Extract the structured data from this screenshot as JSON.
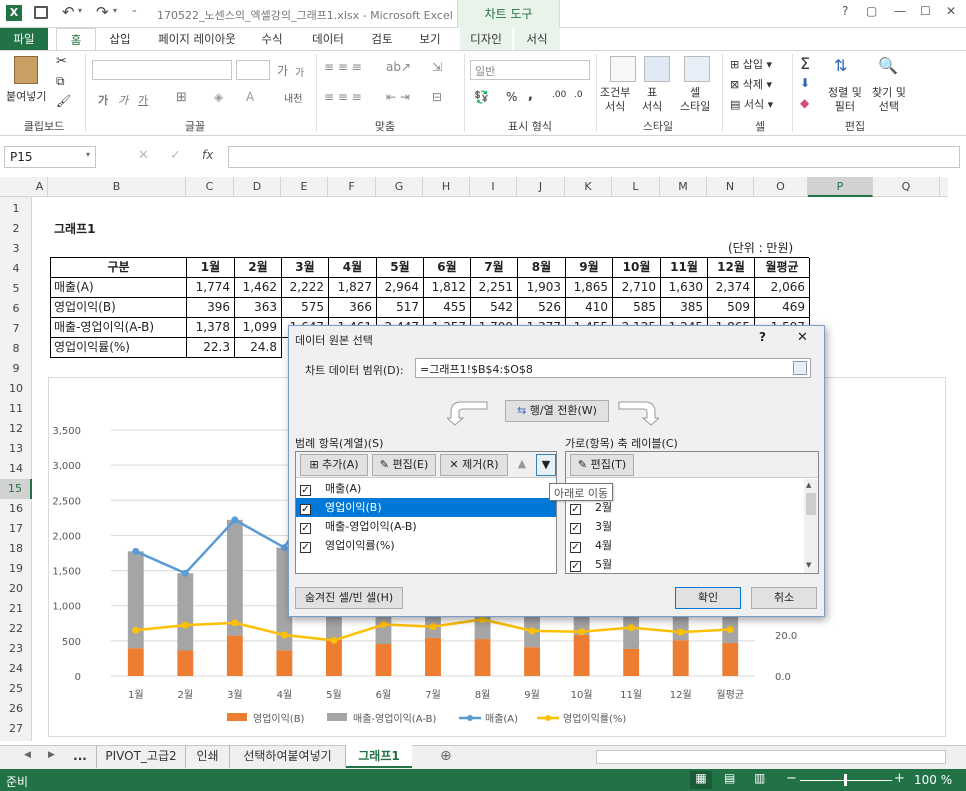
{
  "titlebar": {
    "title": "170522_노센스의_엑셀강의_그래프1.xlsx - Microsoft Excel",
    "chart_tools": "차트 도구",
    "help": "?",
    "restore": "▢",
    "minimize": "—",
    "maximize": "☐",
    "close": "✕"
  },
  "ribbon_tabs": [
    "파일",
    "홈",
    "삽입",
    "페이지 레이아웃",
    "수식",
    "데이터",
    "검토",
    "보기",
    "디자인",
    "서식"
  ],
  "ribbon": {
    "paste": "붙여넣기",
    "clipboard": "클립보드",
    "font": "글꼴",
    "alignment": "맞춤",
    "number_format_value": "일반",
    "number": "표시 형식",
    "cond_format": "조건부\n서식",
    "table_format": "표\n서식",
    "cell_style": "셀\n스타일",
    "styles": "스타일",
    "insert": "삽입",
    "delete": "삭제",
    "format": "서식",
    "cells": "셀",
    "sort_filter": "정렬 및\n필터",
    "find_select": "찾기 및\n선택",
    "editing": "편집",
    "font_size_a": "가",
    "font_size_b": "가",
    "bold": "가",
    "italic": "가",
    "underline": "가",
    "percent": "%",
    "comma": ",",
    "pct_char": "내천"
  },
  "formula_bar": {
    "name_box": "P15",
    "fx": "fx",
    "value": ""
  },
  "columns": [
    "A",
    "B",
    "C",
    "D",
    "E",
    "F",
    "G",
    "H",
    "I",
    "J",
    "K",
    "L",
    "M",
    "N",
    "O",
    "P",
    "Q"
  ],
  "rows": [
    "1",
    "2",
    "3",
    "4",
    "5",
    "6",
    "7",
    "8",
    "9",
    "10",
    "11",
    "12",
    "13",
    "14",
    "15",
    "16",
    "17",
    "18",
    "19",
    "20",
    "21",
    "22",
    "23",
    "24",
    "25",
    "26",
    "27"
  ],
  "sheet": {
    "title": "그래프1",
    "unit": "(단위 : 만원)",
    "header": [
      "구분",
      "1월",
      "2월",
      "3월",
      "4월",
      "5월",
      "6월",
      "7월",
      "8월",
      "9월",
      "10월",
      "11월",
      "12월",
      "월평균"
    ],
    "row_sales": [
      "매출(A)",
      "1,774",
      "1,462",
      "2,222",
      "1,827",
      "2,964",
      "1,812",
      "2,251",
      "1,903",
      "1,865",
      "2,710",
      "1,630",
      "2,374",
      "2,066"
    ],
    "row_profit": [
      "영업이익(B)",
      "396",
      "363",
      "575",
      "366",
      "517",
      "455",
      "542",
      "526",
      "410",
      "585",
      "385",
      "509",
      "469"
    ],
    "row_diff": [
      "매출-영업이익(A-B)",
      "1,378",
      "1,099",
      "1,647",
      "1,461",
      "2,447",
      "1,357",
      "1,709",
      "1,377",
      "1,455",
      "2,125",
      "1,245",
      "1,865",
      "1,597"
    ],
    "row_rate": [
      "영업이익률(%)",
      "22.3",
      "24.8"
    ]
  },
  "chart_data": {
    "type": "bar",
    "categories": [
      "1월",
      "2월",
      "3월",
      "4월",
      "5월",
      "6월",
      "7월",
      "8월",
      "9월",
      "10월",
      "11월",
      "12월",
      "월평균"
    ],
    "series": [
      {
        "name": "영업이익(B)",
        "type": "bar",
        "stack": "s",
        "color": "#ED7D31",
        "values": [
          396,
          363,
          575,
          366,
          517,
          455,
          542,
          526,
          410,
          585,
          385,
          509,
          469
        ]
      },
      {
        "name": "매출-영업이익(A-B)",
        "type": "bar",
        "stack": "s",
        "color": "#A5A5A5",
        "values": [
          1378,
          1099,
          1647,
          1461,
          2447,
          1357,
          1709,
          1377,
          1455,
          2125,
          1245,
          1865,
          1597
        ]
      },
      {
        "name": "매출(A)",
        "type": "line",
        "color": "#5B9BD5",
        "values": [
          1774,
          1462,
          2222,
          1827,
          2964,
          1812,
          2251,
          1903,
          1865,
          2710,
          1630,
          2374,
          2066
        ]
      },
      {
        "name": "영업이익률(%)",
        "type": "line",
        "axis": "secondary",
        "color": "#FFC000",
        "values": [
          22.3,
          24.8,
          25.9,
          20.0,
          17.4,
          25.1,
          24.1,
          27.6,
          22.0,
          21.6,
          23.6,
          21.4,
          22.7
        ]
      }
    ],
    "y_ticks": [
      "0",
      "500",
      "1,000",
      "1,500",
      "2,000",
      "2,500",
      "3,000",
      "3,500"
    ],
    "y2_ticks": [
      "0.0",
      "20.0"
    ],
    "ylim": [
      0,
      3500
    ],
    "y2lim": [
      0,
      120
    ],
    "legend": "bottom"
  },
  "dialog": {
    "title": "데이터 원본 선택",
    "help": "?",
    "close": "✕",
    "range_label": "차트 데이터 범위(D):",
    "range_value": "=그래프1!$B$4:$O$8",
    "switch_button": "행/열 전환(W)",
    "legend_label": "범례 항목(계열)(S)",
    "add": "추가(A)",
    "edit": "편집(E)",
    "remove": "제거(R)",
    "axis_label": "가로(항목) 축 레이블(C)",
    "axis_edit": "편집(T)",
    "tooltip": "아래로 이동",
    "series": [
      "매출(A)",
      "영업이익(B)",
      "매출-영업이익(A-B)",
      "영업이익률(%)"
    ],
    "categories": [
      "1월",
      "2월",
      "3월",
      "4월",
      "5월"
    ],
    "hidden_cells": "숨겨진 셀/빈 셀(H)",
    "ok": "확인",
    "cancel": "취소"
  },
  "sheet_tabs": [
    "...",
    "PIVOT_고급2",
    "인쇄",
    "선택하여붙여넣기",
    "그래프1"
  ],
  "status": {
    "left": "준비",
    "zoom": "100 %",
    "minus": "−",
    "plus": "+"
  }
}
